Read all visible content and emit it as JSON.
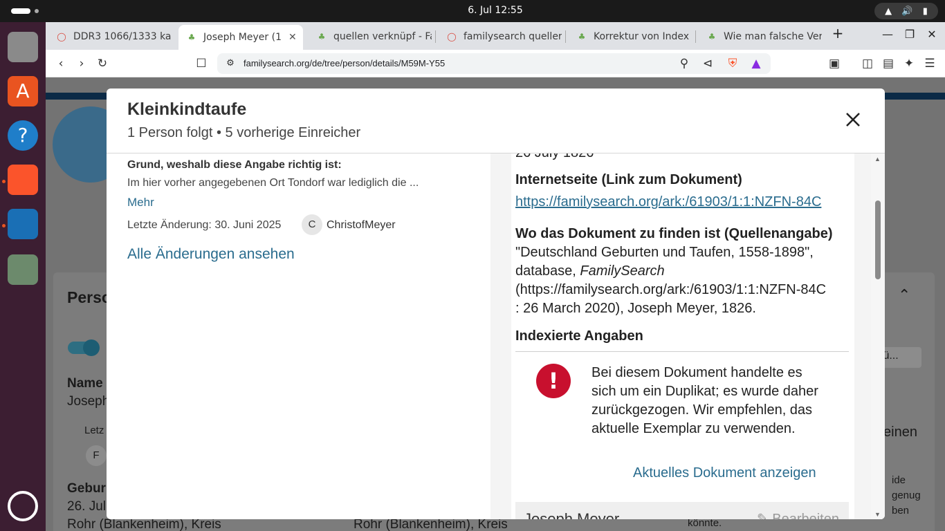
{
  "system": {
    "clock": "6. Jul  12:55"
  },
  "browser": {
    "tabs": [
      {
        "label": "DDR3 1066/1333 ka",
        "icon": "brave-shield-icon"
      },
      {
        "label": "Joseph Meyer (1",
        "icon": "familysearch-tree-icon",
        "active": true
      },
      {
        "label": "quellen verknüpf - Fa",
        "icon": "familysearch-tree-icon"
      },
      {
        "label": "familysearch queller",
        "icon": "brave-shield-icon"
      },
      {
        "label": "Korrektur von Index",
        "icon": "familysearch-tree-icon"
      },
      {
        "label": "Wie man falsche Ver",
        "icon": "familysearch-tree-icon"
      }
    ],
    "url": "familysearch.org/de/tree/person/details/M59M-Y55",
    "shield_badge": "8"
  },
  "background": {
    "person_heading": "Perso",
    "name_label": "Name",
    "name_value": "Joseph",
    "last_change_short": "Letz",
    "avatar_letter": "F",
    "birth_label": "Gebur",
    "birth_date": "26. Jul",
    "birth_place": "Rohr (Blankenheim), Kreis",
    "birth_place_2": "Rohr (Blankenheim), Kreis",
    "button_stub": "fü...",
    "side_word": "einen",
    "side_text": [
      "ide",
      "genug",
      "ben",
      "könnte."
    ]
  },
  "modal": {
    "title": "Kleinkindtaufe",
    "subtitle": "1 Person folgt • 5 vorherige Einreicher",
    "reason_label": "Grund, weshalb diese Angabe richtig ist:",
    "reason_text": "Im hier vorher angegebenen Ort Tondorf war lediglich die ...",
    "more_link": "Mehr",
    "last_change": "Letzte Änderung: 30. Juni 2025",
    "contributor_initial": "C",
    "contributor_name": "ChristofMeyer",
    "all_changes_link": "Alle Änderungen ansehen",
    "right": {
      "date_cut": "26 July 1826",
      "website_heading": "Internetseite (Link zum Dokument)",
      "website_link": "https://familysearch.org/ark:/61903/1:1:NZFN-84C",
      "source_heading": "Wo das Dokument zu finden ist (Quellenangabe)",
      "citation_line1": "\"Deutschland Geburten und Taufen, 1558-1898\",",
      "citation_line2_pre": "database, ",
      "citation_line2_italic": "FamilySearch",
      "citation_line3": "(https://familysearch.org/ark:/61903/1:1:NZFN-84C",
      "citation_line4": ": 26 March 2020), Joseph Meyer, 1826.",
      "indexed_heading": "Indexierte Angaben",
      "alert_text": "Bei diesem Dokument handelte es sich um ein Duplikat; es wurde daher zurückgezogen. Wir empfehlen, das aktuelle Exemplar zu verwenden.",
      "alert_link": "Aktuelles Dokument anzeigen",
      "card_name": "Joseph Meyer",
      "card_edit": "Bearbeiten"
    }
  }
}
